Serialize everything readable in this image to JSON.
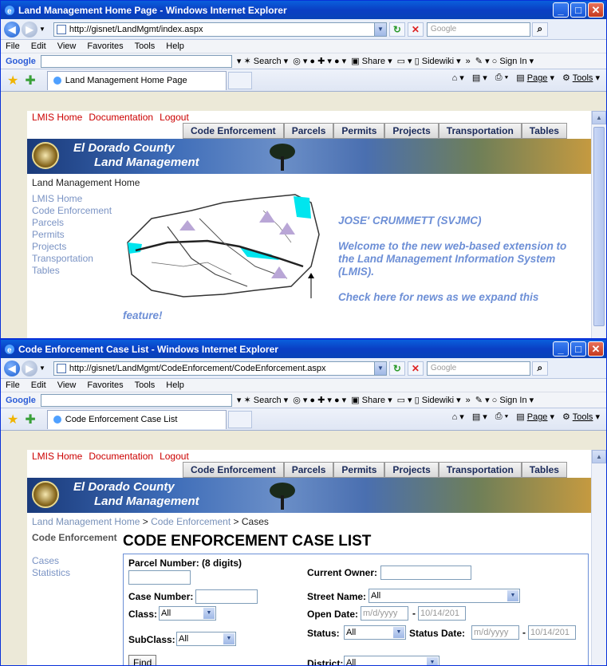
{
  "window1": {
    "title": "Land Management Home Page - Windows Internet Explorer",
    "url": "http://gisnet/LandMgmt/index.aspx",
    "search_placeholder": "Google",
    "menu": [
      "File",
      "Edit",
      "View",
      "Favorites",
      "Tools",
      "Help"
    ],
    "tab_label": "Land Management Home Page",
    "page": {
      "toplinks": [
        "LMIS Home",
        "Documentation",
        "Logout"
      ],
      "nav": [
        "Code Enforcement",
        "Parcels",
        "Permits",
        "Projects",
        "Transportation",
        "Tables"
      ],
      "banner_line1": "El Dorado County",
      "banner_line2": "Land Management",
      "breadcrumb": "Land Management Home",
      "sidenav": [
        "LMIS Home",
        "Code Enforcement",
        "Parcels",
        "Permits",
        "Projects",
        "Transportation",
        "Tables"
      ],
      "user": "JOSE' CRUMMETT (SVJMC)",
      "welcome": "Welcome to the new web-based extension to the Land Management Information System (LMIS).",
      "news": "Check here for news as we expand this",
      "feature": "feature!"
    }
  },
  "window2": {
    "title": "Code Enforcement Case List - Windows Internet Explorer",
    "url": "http://gisnet/LandMgmt/CodeEnforcement/CodeEnforcement.aspx",
    "search_placeholder": "Google",
    "menu": [
      "File",
      "Edit",
      "View",
      "Favorites",
      "Tools",
      "Help"
    ],
    "tab_label": "Code Enforcement Case List",
    "page": {
      "toplinks": [
        "LMIS Home",
        "Documentation",
        "Logout"
      ],
      "nav": [
        "Code Enforcement",
        "Parcels",
        "Permits",
        "Projects",
        "Transportation",
        "Tables"
      ],
      "banner_line1": "El Dorado County",
      "banner_line2": "Land Management",
      "breadcrumb_home": "Land Management Home",
      "breadcrumb_ce": "Code Enforcement",
      "breadcrumb_cases": "Cases",
      "sidenav_header": "Code Enforcement",
      "sidenav": [
        "Cases",
        "Statistics"
      ],
      "heading": "CODE ENFORCEMENT CASE LIST",
      "form": {
        "parcel_label": "Parcel Number: (8 digits)",
        "owner_label": "Current Owner:",
        "case_label": "Case Number:",
        "street_label": "Street Name:",
        "street_value": "All",
        "class_label": "Class:",
        "class_value": "All",
        "open_label": "Open Date:",
        "open_from": "m/d/yyyy",
        "open_to": "10/14/201",
        "subclass_label": "SubClass:",
        "subclass_value": "All",
        "status_label": "Status:",
        "status_value": "All",
        "status_date_label": "Status Date:",
        "status_from": "m/d/yyyy",
        "status_to": "10/14/201",
        "find_button": "Find",
        "district_label": "District:",
        "district_value": "All"
      }
    }
  },
  "toolbar": {
    "google": "Google",
    "search": "Search",
    "share": "Share",
    "sidewiki": "Sidewiki",
    "more": "»",
    "signin": "Sign In",
    "page_menu": "Page",
    "tools_menu": "Tools"
  }
}
